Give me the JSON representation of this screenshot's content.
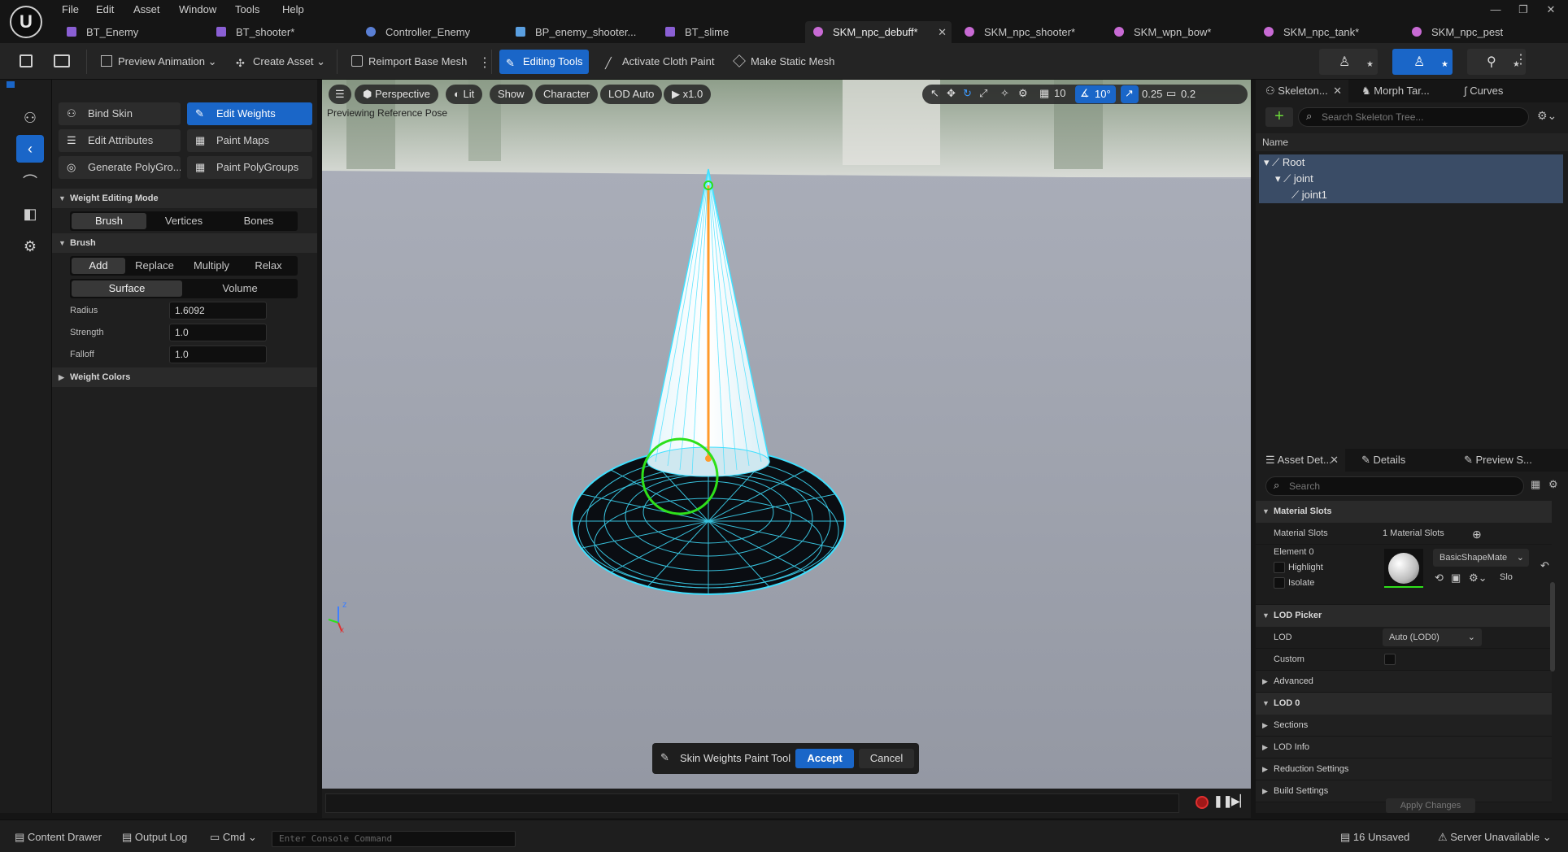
{
  "app": {
    "logo_letter": "U"
  },
  "menu": [
    "File",
    "Edit",
    "Asset",
    "Window",
    "Tools",
    "Help"
  ],
  "window_buttons": {
    "minimize": "—",
    "restore": "❐",
    "close": "✕"
  },
  "tabs": [
    {
      "label": "BT_Enemy",
      "color": "#8a5fd4"
    },
    {
      "label": "BT_shooter*",
      "color": "#8a5fd4"
    },
    {
      "label": "Controller_Enemy",
      "color": "#5a7fd4"
    },
    {
      "label": "BP_enemy_shooter...",
      "color": "#5a9fe0"
    },
    {
      "label": "BT_slime",
      "color": "#8a5fd4"
    },
    {
      "label": "SKM_npc_debuff*",
      "color": "#c86ad4"
    },
    {
      "label": "SKM_npc_shooter*",
      "color": "#c86ad4"
    },
    {
      "label": "SKM_wpn_bow*",
      "color": "#c86ad4"
    },
    {
      "label": "SKM_npc_tank*",
      "color": "#c86ad4"
    },
    {
      "label": "SKM_npc_pest",
      "color": "#c86ad4"
    }
  ],
  "toolbar": {
    "preview_animation": "Preview Animation",
    "create_asset": "Create Asset",
    "reimport": "Reimport Base Mesh",
    "editing_tools": "Editing Tools",
    "cloth_paint": "Activate Cloth Paint",
    "static_mesh": "Make Static Mesh"
  },
  "left_tools": {
    "bind_skin": "Bind Skin",
    "edit_weights": "Edit Weights",
    "edit_attributes": "Edit Attributes",
    "paint_maps": "Paint Maps",
    "generate_polygroups": "Generate PolyGro...",
    "paint_polygroups": "Paint PolyGroups"
  },
  "weight_mode": {
    "title": "Weight Editing Mode",
    "options": [
      "Brush",
      "Vertices",
      "Bones"
    ],
    "selected": "Brush"
  },
  "brush": {
    "title": "Brush",
    "ops": [
      "Add",
      "Replace",
      "Multiply",
      "Relax"
    ],
    "selected_op": "Add",
    "space": [
      "Surface",
      "Volume"
    ],
    "selected_space": "Surface",
    "radius_label": "Radius",
    "radius": "1.6092",
    "strength_label": "Strength",
    "strength": "1.0",
    "falloff_label": "Falloff",
    "falloff": "1.0"
  },
  "weight_colors": "Weight Colors",
  "viewport": {
    "perspective": "Perspective",
    "lit": "Lit",
    "show": "Show",
    "character": "Character",
    "lod": "LOD Auto",
    "speed": "x1.0",
    "grid_snap": "10",
    "rot_snap": "10°",
    "scale_snap": "0.25",
    "cam_speed": "0.2",
    "status_text": "Previewing Reference Pose"
  },
  "tool_dialog": {
    "label": "Skin Weights Paint Tool",
    "accept": "Accept",
    "cancel": "Cancel"
  },
  "skeleton": {
    "tabs": [
      "Skeleton...",
      "Morph Tar...",
      "Curves"
    ],
    "search_placeholder": "Search Skeleton Tree...",
    "column": "Name",
    "bones": [
      "Root",
      "joint",
      "joint1"
    ]
  },
  "details": {
    "tabs": [
      "Asset Det...",
      "Details",
      "Preview S..."
    ],
    "search_placeholder": "Search",
    "material_slots_head": "Material Slots",
    "material_slots_label": "Material Slots",
    "material_slots_value": "1 Material Slots",
    "element0": "Element 0",
    "highlight": "Highlight",
    "isolate": "Isolate",
    "material_name": "BasicShapeMate",
    "slot_abbrev": "Slo",
    "lod_picker_head": "LOD Picker",
    "lod_label": "LOD",
    "lod_value": "Auto (LOD0)",
    "custom_label": "Custom",
    "advanced": "Advanced",
    "lod0_head": "LOD 0",
    "sections": "Sections",
    "lod_info": "LOD Info",
    "reduction": "Reduction Settings",
    "build": "Build Settings",
    "apply": "Apply Changes"
  },
  "statusbar": {
    "content_drawer": "Content Drawer",
    "output_log": "Output Log",
    "cmd": "Cmd",
    "console_placeholder": "Enter Console Command",
    "unsaved": "16 Unsaved",
    "server": "Server Unavailable"
  },
  "colors": {
    "accent": "#1a66c8",
    "wire": "#3fe0ff",
    "bone": "#ff9a2a",
    "brush_ring": "#2ee01a"
  }
}
